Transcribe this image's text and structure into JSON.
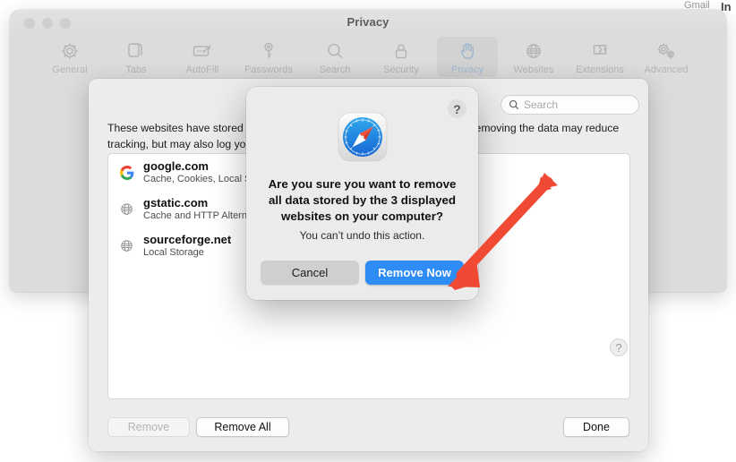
{
  "background": {
    "gmail_label": "Gmail",
    "inbox_label": "In"
  },
  "prefs_window": {
    "title": "Privacy",
    "traffic_lights": [
      "close",
      "minimize",
      "maximize"
    ],
    "toolbar": {
      "items": [
        {
          "label": "General",
          "icon": "gear-icon",
          "selected": false
        },
        {
          "label": "Tabs",
          "icon": "tabs-icon",
          "selected": false
        },
        {
          "label": "AutoFill",
          "icon": "autofill-icon",
          "selected": false
        },
        {
          "label": "Passwords",
          "icon": "key-icon",
          "selected": false
        },
        {
          "label": "Search",
          "icon": "search-icon",
          "selected": false
        },
        {
          "label": "Security",
          "icon": "lock-icon",
          "selected": false
        },
        {
          "label": "Privacy",
          "icon": "hand-icon",
          "selected": true
        },
        {
          "label": "Websites",
          "icon": "globe-icon",
          "selected": false
        },
        {
          "label": "Extensions",
          "icon": "puzzle-icon",
          "selected": false
        },
        {
          "label": "Advanced",
          "icon": "gears-icon",
          "selected": false
        }
      ]
    }
  },
  "sheet": {
    "search": {
      "placeholder": "Search",
      "value": "",
      "icon": "search-icon"
    },
    "description": "These websites have stored data that can be used to track your browsing. Removing the data may reduce tracking, but may also log you out or change website behaviour.",
    "sites": [
      {
        "name": "google.com",
        "detail": "Cache, Cookies, Local Storage",
        "favicon": "google-favicon"
      },
      {
        "name": "gstatic.com",
        "detail": "Cache and HTTP Alternate Services",
        "favicon": "globe-favicon"
      },
      {
        "name": "sourceforge.net",
        "detail": "Local Storage",
        "favicon": "globe-favicon"
      }
    ],
    "buttons": {
      "remove": "Remove",
      "remove_disabled": true,
      "remove_all": "Remove All",
      "done": "Done"
    },
    "help_glyph": "?"
  },
  "alert": {
    "help_glyph": "?",
    "app_icon": "safari-icon",
    "title": "Are you sure you want to remove all data stored by the 3 displayed websites on your computer?",
    "subtitle": "You can’t undo this action.",
    "cancel_label": "Cancel",
    "confirm_label": "Remove Now",
    "confirm_color": "#2d8cf5"
  },
  "annotation": {
    "arrow_color": "#f04a34",
    "points_to": "Remove Now"
  }
}
